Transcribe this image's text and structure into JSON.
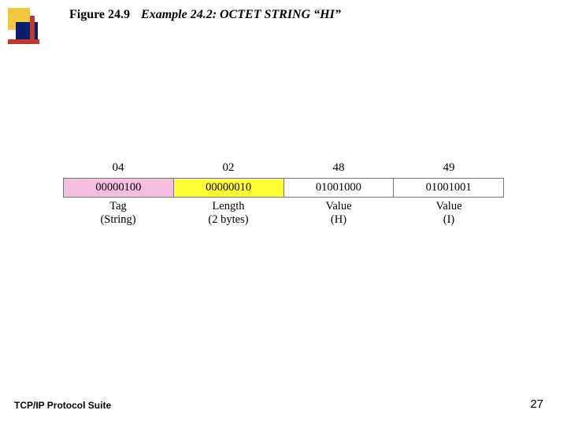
{
  "title": {
    "figure_label": "Figure 24.9",
    "caption": "Example 24.2: OCTET STRING “HI”"
  },
  "diagram": {
    "cols": [
      {
        "hex": "04",
        "bin": "00000100",
        "label1": "Tag",
        "label2": "(String)",
        "bg": "pink"
      },
      {
        "hex": "02",
        "bin": "00000010",
        "label1": "Length",
        "label2": "(2 bytes)",
        "bg": "yellow"
      },
      {
        "hex": "48",
        "bin": "01001000",
        "label1": "Value",
        "label2": "(H)",
        "bg": "white"
      },
      {
        "hex": "49",
        "bin": "01001001",
        "label1": "Value",
        "label2": "(I)",
        "bg": "white"
      }
    ]
  },
  "footer": {
    "left": "TCP/IP Protocol Suite",
    "page": "27"
  },
  "decor": {
    "colors": {
      "gold": "#f0c93e",
      "navy": "#0a1f6b",
      "red": "#c0392b"
    }
  }
}
